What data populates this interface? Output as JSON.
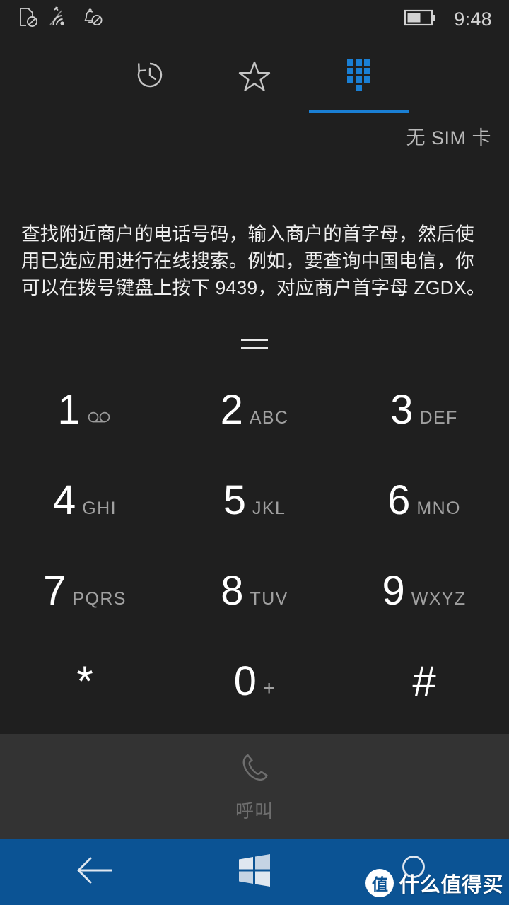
{
  "status_bar": {
    "icons": [
      {
        "name": "sim-card-missing-icon",
        "label": "no-sim"
      },
      {
        "name": "wifi-signal-icon",
        "label": "wifi"
      },
      {
        "name": "notifications-off-icon",
        "label": "silent"
      }
    ],
    "battery": {
      "name": "battery-icon",
      "level_percent": 55
    },
    "time": "9:48"
  },
  "tabs": [
    {
      "id": "history",
      "icon": "history-clock-icon",
      "active": false
    },
    {
      "id": "favorites",
      "icon": "star-icon",
      "active": false
    },
    {
      "id": "dialpad",
      "icon": "dialpad-dots-icon",
      "active": true
    }
  ],
  "sim_status": "无 SIM 卡",
  "hint": "查找附近商户的电话号码，输入商户的首字母，然后使用已选应用进行在线搜索。例如，要查询中国电信，你可以在拨号键盘上按下 9439，对应商户首字母 ZGDX。",
  "drag_handle": {
    "name": "dialpad-drag-handle"
  },
  "dialpad": {
    "keys": [
      {
        "digit": "1",
        "letters": "",
        "icon": "voicemail-icon"
      },
      {
        "digit": "2",
        "letters": "ABC",
        "icon": ""
      },
      {
        "digit": "3",
        "letters": "DEF",
        "icon": ""
      },
      {
        "digit": "4",
        "letters": "GHI",
        "icon": ""
      },
      {
        "digit": "5",
        "letters": "JKL",
        "icon": ""
      },
      {
        "digit": "6",
        "letters": "MNO",
        "icon": ""
      },
      {
        "digit": "7",
        "letters": "PQRS",
        "icon": ""
      },
      {
        "digit": "8",
        "letters": "TUV",
        "icon": ""
      },
      {
        "digit": "9",
        "letters": "WXYZ",
        "icon": ""
      },
      {
        "digit": "*",
        "letters": "",
        "icon": ""
      },
      {
        "digit": "0",
        "letters": "+",
        "icon": ""
      },
      {
        "digit": "#",
        "letters": "",
        "icon": ""
      }
    ]
  },
  "call_bar": {
    "icon": "phone-handset-icon",
    "label": "呼叫",
    "enabled": false
  },
  "nav_bar": [
    {
      "id": "back",
      "icon": "back-arrow-icon"
    },
    {
      "id": "home",
      "icon": "windows-logo-icon"
    },
    {
      "id": "search",
      "icon": "search-magnifier-icon"
    }
  ],
  "watermark": {
    "badge": "值",
    "text": "什么值得买"
  },
  "colors": {
    "background": "#1f1f1f",
    "call_bar": "#333333",
    "nav_bar": "#0b5394",
    "accent": "#1a7fd4",
    "primary_text": "#ffffff",
    "secondary_text": "#a0a0a0",
    "disabled_text": "#6e6e6e"
  }
}
